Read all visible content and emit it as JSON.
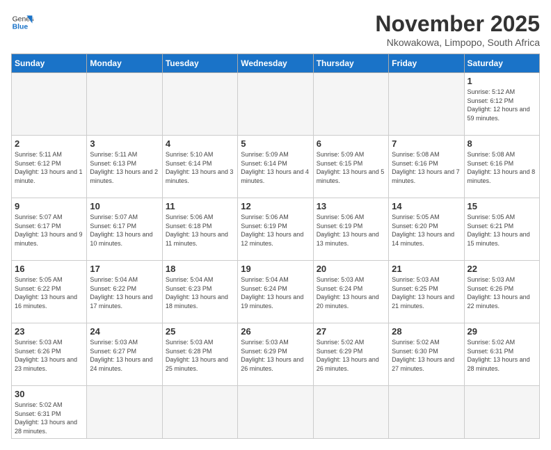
{
  "header": {
    "logo_general": "General",
    "logo_blue": "Blue",
    "title": "November 2025",
    "subtitle": "Nkowakowa, Limpopo, South Africa"
  },
  "days_of_week": [
    "Sunday",
    "Monday",
    "Tuesday",
    "Wednesday",
    "Thursday",
    "Friday",
    "Saturday"
  ],
  "weeks": [
    [
      {
        "day": "",
        "info": ""
      },
      {
        "day": "",
        "info": ""
      },
      {
        "day": "",
        "info": ""
      },
      {
        "day": "",
        "info": ""
      },
      {
        "day": "",
        "info": ""
      },
      {
        "day": "",
        "info": ""
      },
      {
        "day": "1",
        "info": "Sunrise: 5:12 AM\nSunset: 6:12 PM\nDaylight: 12 hours and 59 minutes."
      }
    ],
    [
      {
        "day": "2",
        "info": "Sunrise: 5:11 AM\nSunset: 6:12 PM\nDaylight: 13 hours and 1 minute."
      },
      {
        "day": "3",
        "info": "Sunrise: 5:11 AM\nSunset: 6:13 PM\nDaylight: 13 hours and 2 minutes."
      },
      {
        "day": "4",
        "info": "Sunrise: 5:10 AM\nSunset: 6:14 PM\nDaylight: 13 hours and 3 minutes."
      },
      {
        "day": "5",
        "info": "Sunrise: 5:09 AM\nSunset: 6:14 PM\nDaylight: 13 hours and 4 minutes."
      },
      {
        "day": "6",
        "info": "Sunrise: 5:09 AM\nSunset: 6:15 PM\nDaylight: 13 hours and 5 minutes."
      },
      {
        "day": "7",
        "info": "Sunrise: 5:08 AM\nSunset: 6:16 PM\nDaylight: 13 hours and 7 minutes."
      },
      {
        "day": "8",
        "info": "Sunrise: 5:08 AM\nSunset: 6:16 PM\nDaylight: 13 hours and 8 minutes."
      }
    ],
    [
      {
        "day": "9",
        "info": "Sunrise: 5:07 AM\nSunset: 6:17 PM\nDaylight: 13 hours and 9 minutes."
      },
      {
        "day": "10",
        "info": "Sunrise: 5:07 AM\nSunset: 6:17 PM\nDaylight: 13 hours and 10 minutes."
      },
      {
        "day": "11",
        "info": "Sunrise: 5:06 AM\nSunset: 6:18 PM\nDaylight: 13 hours and 11 minutes."
      },
      {
        "day": "12",
        "info": "Sunrise: 5:06 AM\nSunset: 6:19 PM\nDaylight: 13 hours and 12 minutes."
      },
      {
        "day": "13",
        "info": "Sunrise: 5:06 AM\nSunset: 6:19 PM\nDaylight: 13 hours and 13 minutes."
      },
      {
        "day": "14",
        "info": "Sunrise: 5:05 AM\nSunset: 6:20 PM\nDaylight: 13 hours and 14 minutes."
      },
      {
        "day": "15",
        "info": "Sunrise: 5:05 AM\nSunset: 6:21 PM\nDaylight: 13 hours and 15 minutes."
      }
    ],
    [
      {
        "day": "16",
        "info": "Sunrise: 5:05 AM\nSunset: 6:22 PM\nDaylight: 13 hours and 16 minutes."
      },
      {
        "day": "17",
        "info": "Sunrise: 5:04 AM\nSunset: 6:22 PM\nDaylight: 13 hours and 17 minutes."
      },
      {
        "day": "18",
        "info": "Sunrise: 5:04 AM\nSunset: 6:23 PM\nDaylight: 13 hours and 18 minutes."
      },
      {
        "day": "19",
        "info": "Sunrise: 5:04 AM\nSunset: 6:24 PM\nDaylight: 13 hours and 19 minutes."
      },
      {
        "day": "20",
        "info": "Sunrise: 5:03 AM\nSunset: 6:24 PM\nDaylight: 13 hours and 20 minutes."
      },
      {
        "day": "21",
        "info": "Sunrise: 5:03 AM\nSunset: 6:25 PM\nDaylight: 13 hours and 21 minutes."
      },
      {
        "day": "22",
        "info": "Sunrise: 5:03 AM\nSunset: 6:26 PM\nDaylight: 13 hours and 22 minutes."
      }
    ],
    [
      {
        "day": "23",
        "info": "Sunrise: 5:03 AM\nSunset: 6:26 PM\nDaylight: 13 hours and 23 minutes."
      },
      {
        "day": "24",
        "info": "Sunrise: 5:03 AM\nSunset: 6:27 PM\nDaylight: 13 hours and 24 minutes."
      },
      {
        "day": "25",
        "info": "Sunrise: 5:03 AM\nSunset: 6:28 PM\nDaylight: 13 hours and 25 minutes."
      },
      {
        "day": "26",
        "info": "Sunrise: 5:03 AM\nSunset: 6:29 PM\nDaylight: 13 hours and 26 minutes."
      },
      {
        "day": "27",
        "info": "Sunrise: 5:02 AM\nSunset: 6:29 PM\nDaylight: 13 hours and 26 minutes."
      },
      {
        "day": "28",
        "info": "Sunrise: 5:02 AM\nSunset: 6:30 PM\nDaylight: 13 hours and 27 minutes."
      },
      {
        "day": "29",
        "info": "Sunrise: 5:02 AM\nSunset: 6:31 PM\nDaylight: 13 hours and 28 minutes."
      }
    ],
    [
      {
        "day": "30",
        "info": "Sunrise: 5:02 AM\nSunset: 6:31 PM\nDaylight: 13 hours and 28 minutes."
      },
      {
        "day": "",
        "info": ""
      },
      {
        "day": "",
        "info": ""
      },
      {
        "day": "",
        "info": ""
      },
      {
        "day": "",
        "info": ""
      },
      {
        "day": "",
        "info": ""
      },
      {
        "day": "",
        "info": ""
      }
    ]
  ]
}
